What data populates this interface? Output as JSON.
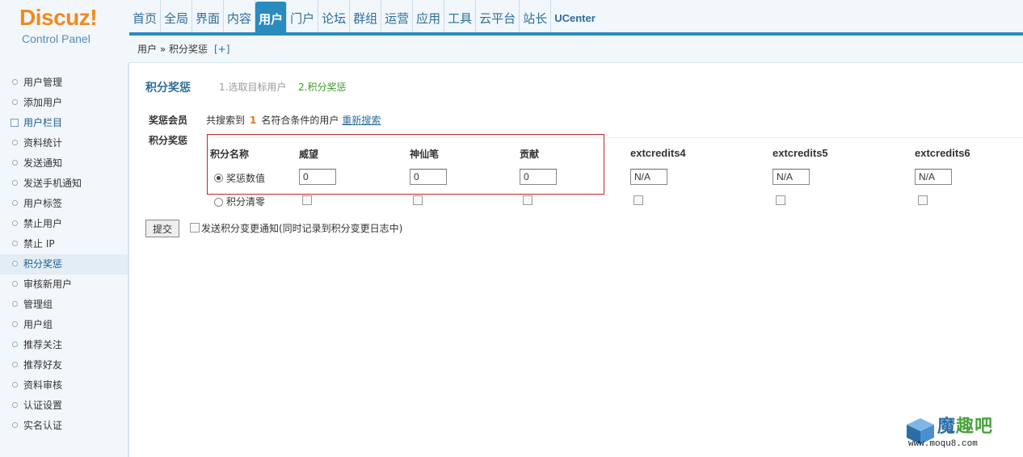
{
  "logo": {
    "brand": "Discuz!",
    "sub": "Control Panel"
  },
  "nav": {
    "items": [
      "首页",
      "全局",
      "界面",
      "内容",
      "用户",
      "门户",
      "论坛",
      "群组",
      "运营",
      "应用",
      "工具",
      "云平台",
      "站长",
      "UCenter"
    ],
    "active": "用户"
  },
  "breadcrumb": {
    "text": "用户 » 积分奖惩",
    "plus": "[+]"
  },
  "sidebar": {
    "items": [
      "用户管理",
      "添加用户",
      "用户栏目",
      "资料统计",
      "发送通知",
      "发送手机通知",
      "用户标签",
      "禁止用户",
      "禁止 IP",
      "积分奖惩",
      "审核新用户",
      "管理组",
      "用户组",
      "推荐关注",
      "推荐好友",
      "资料审核",
      "认证设置",
      "实名认证"
    ],
    "active": "积分奖惩",
    "column_item": "用户栏目"
  },
  "main": {
    "title": "积分奖惩",
    "step1": "1.选取目标用户",
    "step2": "2.积分奖惩",
    "member_label": "奖惩会员",
    "search_prefix": "共搜索到",
    "search_count": "1",
    "search_suffix": "名符合条件的用户",
    "research_link": "重新搜索",
    "credits_label": "积分奖惩",
    "header_name": "积分名称",
    "credits": [
      "威望",
      "神仙笔",
      "贡献",
      "extcredits4",
      "extcredits5",
      "extcredits6"
    ],
    "row_value_label": "奖惩数值",
    "row_clear_label": "积分清零",
    "values": [
      "0",
      "0",
      "0",
      "N/A",
      "N/A",
      "N/A"
    ],
    "submit_label": "提交",
    "notify_label": "发送积分变更通知(同时记录到积分变更日志中)"
  },
  "watermark": {
    "text_a": "魔",
    "text_b": "趣吧",
    "url": "www.moqu8.com"
  },
  "colors": {
    "accent": "#2a8bbf",
    "highlight": "#c0262c",
    "logo": "#f08a1e"
  }
}
